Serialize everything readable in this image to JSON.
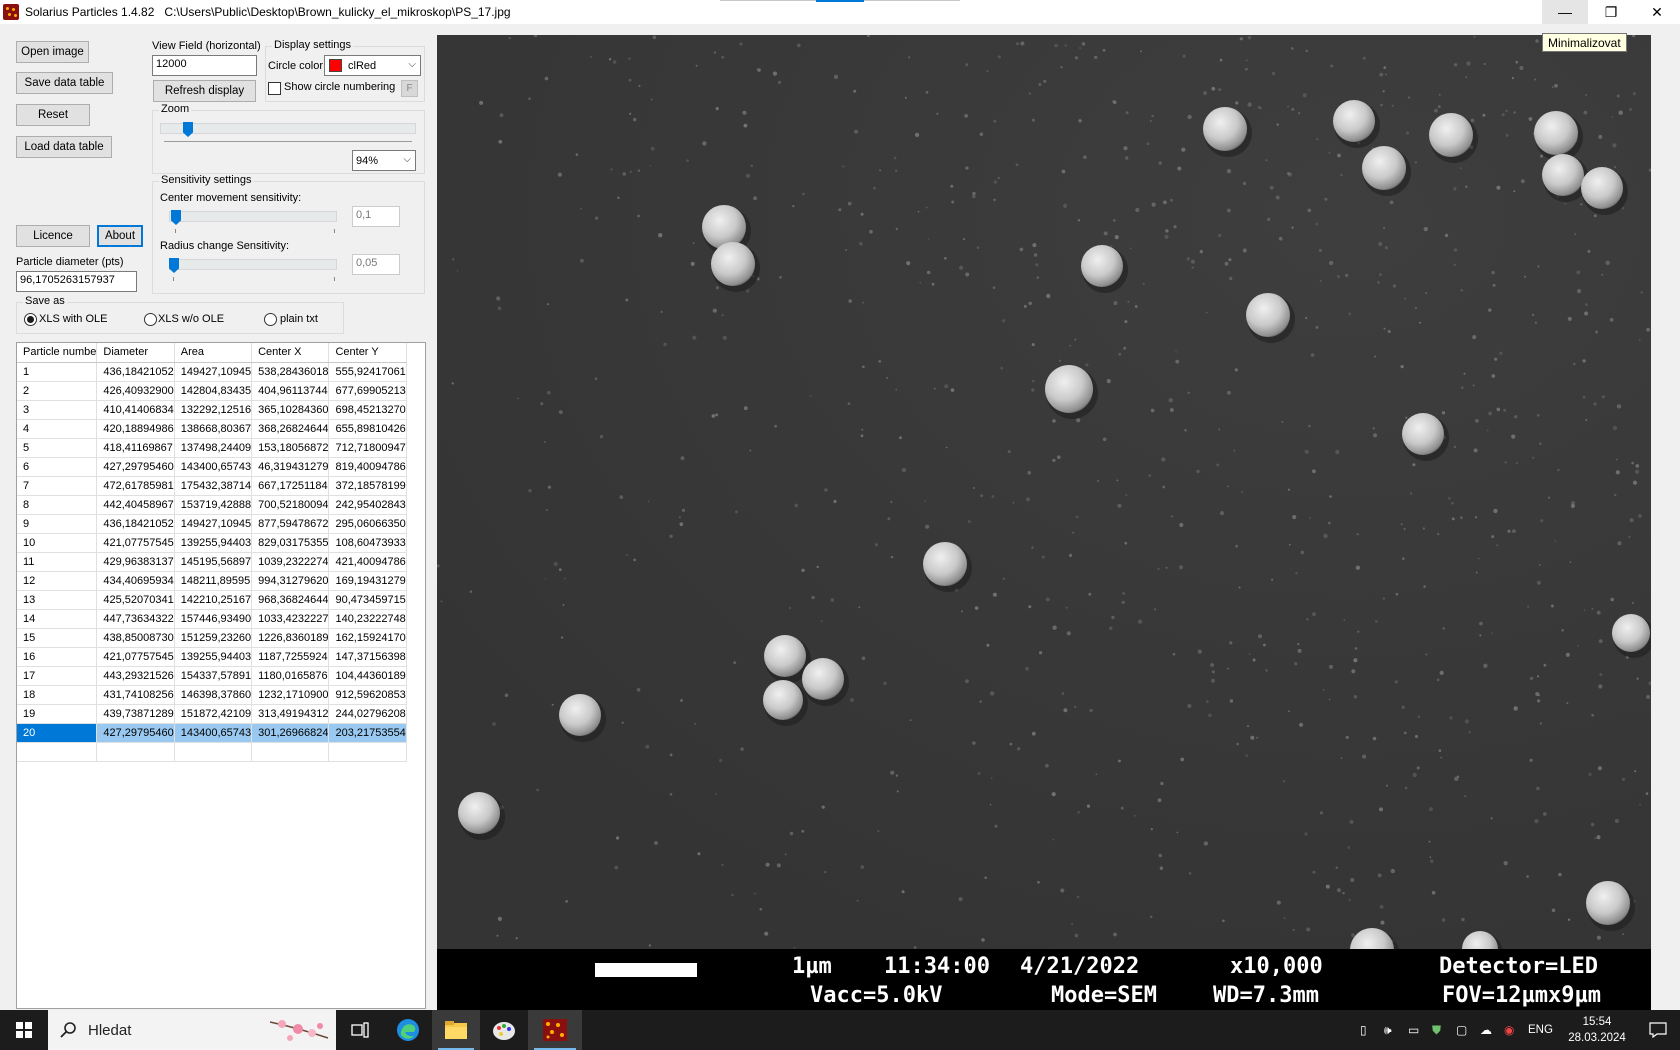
{
  "window": {
    "title": "Solarius Particles 1.4.82",
    "path": "C:\\Users\\Public\\Desktop\\Brown_kulicky_el_mikroskop\\PS_17.jpg",
    "minimize_symbol": "—",
    "maximize_symbol": "❐",
    "close_symbol": "✕",
    "tooltip": "Minimalizovat"
  },
  "buttons": {
    "open_image": "Open image",
    "save_data_table": "Save data table",
    "reset": "Reset",
    "load_data_table": "Load data table",
    "licence": "Licence",
    "about": "About",
    "refresh_display": "Refresh display",
    "f_button": "F"
  },
  "view_field": {
    "label": "View Field (horizontal)",
    "value": "12000"
  },
  "display_settings": {
    "title": "Display settings",
    "circle_color_label": "Circle color",
    "circle_color_value": "clRed",
    "circle_color_hex": "#ff0000",
    "show_numbering_label": "Show circle numbering",
    "show_numbering_checked": false
  },
  "zoom": {
    "title": "Zoom",
    "value": "94%",
    "slider_fraction": 0.08
  },
  "sensitivity": {
    "title": "Sensitivity settings",
    "center_label": "Center movement sensitivity:",
    "center_value": "0,1",
    "center_fraction": 0.03,
    "radius_label": "Radius change Sensitivity:",
    "radius_value": "0,05",
    "radius_fraction": 0.02
  },
  "particle_diameter": {
    "label": "Particle diameter (pts)",
    "value": "96,1705263157937"
  },
  "save_as": {
    "title": "Save as",
    "options": [
      "XLS with OLE",
      "XLS w/o OLE",
      "plain txt"
    ],
    "selected": "XLS with OLE"
  },
  "table": {
    "headers": [
      "Particle numbe",
      "Diameter",
      "Area",
      "Center X",
      "Center Y"
    ],
    "rows": [
      [
        "1",
        "436,18421052",
        "149427,10945",
        "538,28436018",
        "555,92417061"
      ],
      [
        "2",
        "426,40932900",
        "142804,83435",
        "404,96113744",
        "677,69905213"
      ],
      [
        "3",
        "410,41406834",
        "132292,12516",
        "365,10284360",
        "698,45213270"
      ],
      [
        "4",
        "420,18894986",
        "138668,80367",
        "368,26824644",
        "655,89810426"
      ],
      [
        "5",
        "418,41169867",
        "137498,24409",
        "153,18056872",
        "712,71800947"
      ],
      [
        "6",
        "427,29795460",
        "143400,65743",
        "46,319431279",
        "819,40094786"
      ],
      [
        "7",
        "472,61785981",
        "175432,38714",
        "667,17251184",
        "372,18578199"
      ],
      [
        "8",
        "442,40458967",
        "153719,42888",
        "700,52180094",
        "242,95402843"
      ],
      [
        "9",
        "436,18421052",
        "149427,10945",
        "877,59478672",
        "295,06066350"
      ],
      [
        "10",
        "421,07757545",
        "139255,94403",
        "829,03175355",
        "108,60473933"
      ],
      [
        "11",
        "429,96383137",
        "145195,56897",
        "1039,2322274",
        "421,40094786"
      ],
      [
        "12",
        "434,40695934",
        "148211,89595",
        "994,31279620",
        "169,19431279"
      ],
      [
        "13",
        "425,52070341",
        "142210,25167",
        "968,36824644",
        "90,473459715"
      ],
      [
        "14",
        "447,73634322",
        "157446,93490",
        "1033,4232227",
        "140,23222748"
      ],
      [
        "15",
        "438,85008730",
        "151259,23260",
        "1226,8360189",
        "162,15924170"
      ],
      [
        "16",
        "421,07757545",
        "139255,94403",
        "1187,7255924",
        "147,37156398"
      ],
      [
        "17",
        "443,29321526",
        "154337,57891",
        "1180,0165876",
        "104,44360189"
      ],
      [
        "18",
        "431,74108256",
        "146398,37860",
        "1232,1710900",
        "912,59620853"
      ],
      [
        "19",
        "439,73871289",
        "151872,42109",
        "313,49194312",
        "244,02796208"
      ],
      [
        "20",
        "427,29795460",
        "143400,65743",
        "301,26966824",
        "203,21753554"
      ],
      [
        "",
        "",
        "",
        "",
        ""
      ]
    ],
    "selected_row": 19
  },
  "sem_info": {
    "scale": "1µm",
    "time": "11:34:00",
    "date": "4/21/2022",
    "magnification": "x10,000",
    "detector": "Detector=LED",
    "vacc": "Vacc=5.0kV",
    "mode": "Mode=SEM",
    "wd": "WD=7.3mm",
    "fov": "FOV=12µmx9µm"
  },
  "taskbar": {
    "search_placeholder": "Hledat",
    "language": "ENG",
    "time": "15:54",
    "date": "28.03.2024"
  }
}
